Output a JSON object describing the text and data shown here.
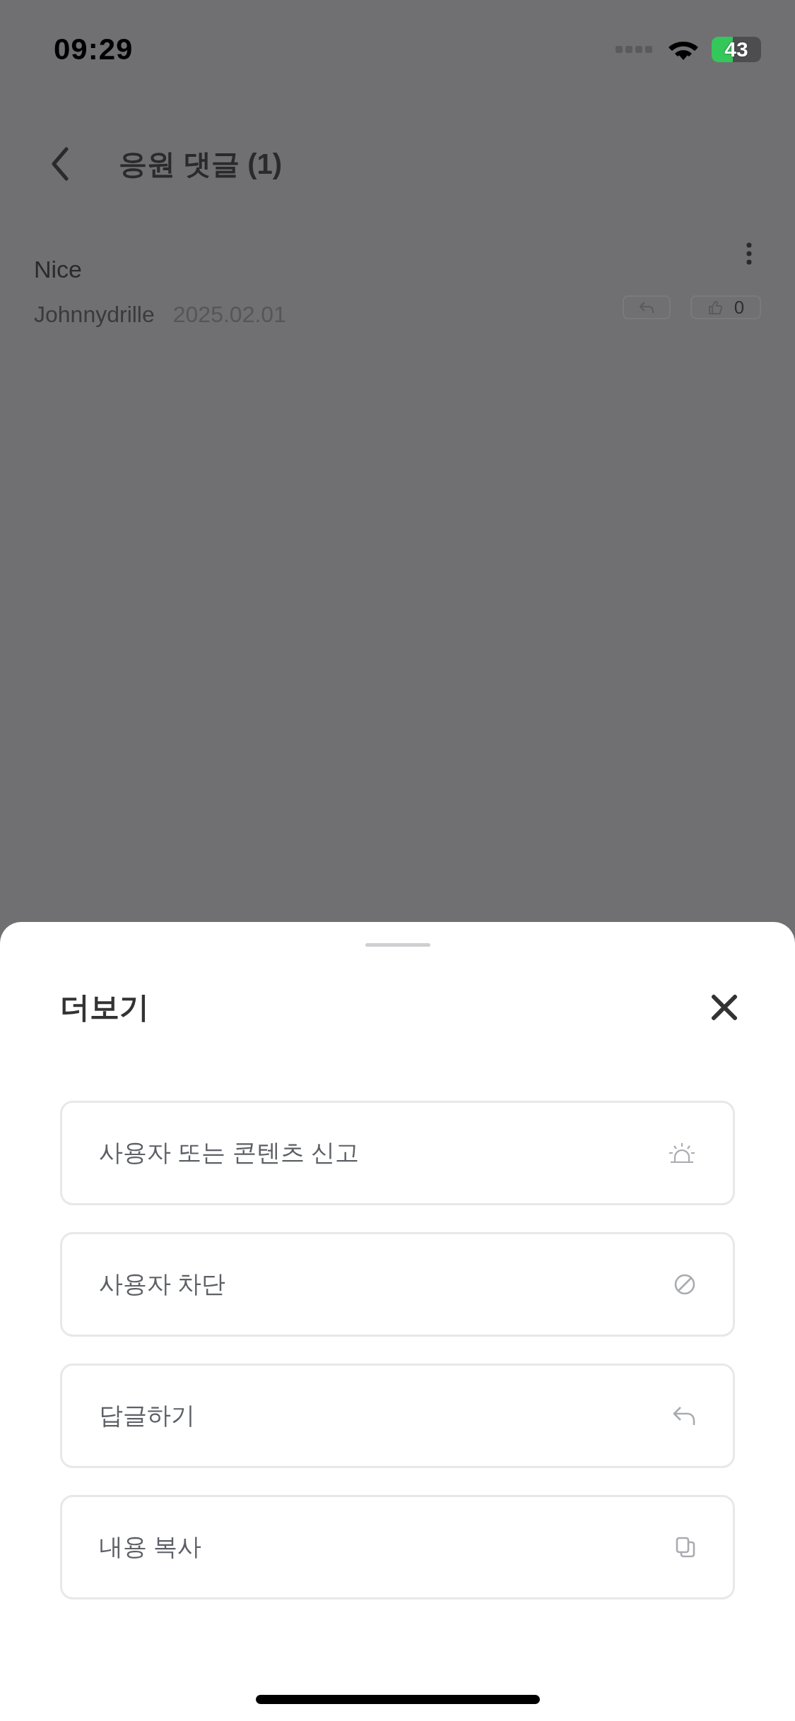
{
  "status_bar": {
    "time": "09:29",
    "battery": "43"
  },
  "header": {
    "title": "응원 댓글 (1)"
  },
  "comments": [
    {
      "text": "Nice",
      "author": "Johnnydrille",
      "date": "2025.02.01",
      "likes": "0"
    }
  ],
  "sheet": {
    "title": "더보기",
    "items": [
      {
        "kind": "report",
        "label": "사용자 또는 콘텐츠 신고"
      },
      {
        "kind": "block",
        "label": "사용자 차단"
      },
      {
        "kind": "reply",
        "label": "답글하기"
      },
      {
        "kind": "copy",
        "label": "내용 복사"
      }
    ]
  }
}
